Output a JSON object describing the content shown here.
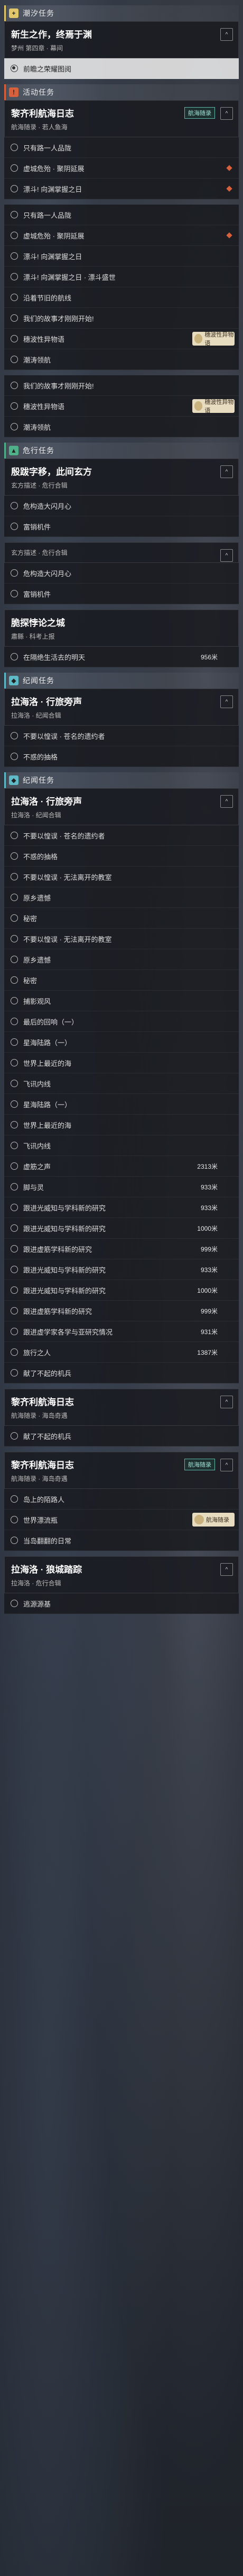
{
  "sections": [
    {
      "head": "潮汐任务",
      "color": "yellow",
      "icon": "+",
      "card": {
        "title": "新生之作，终焉于渊",
        "sub": "梦州 第四章 · 幕间",
        "tag": "",
        "fold": "^"
      },
      "rows": [
        {
          "label": "前瞻之荣耀图阅",
          "active": true
        }
      ]
    },
    {
      "head": "活动任务",
      "color": "red",
      "icon": "!",
      "card": {
        "title": "黎齐利航海日志",
        "sub": "航海随录 · 若人鱼海",
        "tag": "航海随录",
        "fold": "^"
      },
      "rows": [
        {
          "label": "只有路一人品陇"
        },
        {
          "label": "虚城危殆 · 聚阴延展",
          "dia": true
        },
        {
          "label": "漂斗! 向渊掌握之日",
          "dia": true
        }
      ]
    },
    {
      "head": "",
      "color": "yellow",
      "icon": "+",
      "card": null,
      "rows": [
        {
          "label": "只有路一人品陇"
        },
        {
          "label": "虚城危殆 · 聚阴延展",
          "dia": true
        },
        {
          "label": "漂斗! 向渊掌握之日"
        },
        {
          "label": "漂斗! 向渊掌握之日 · 漂斗盛世"
        },
        {
          "label": "沿着节旧的航线"
        },
        {
          "label": "我们的故事才刚刚开始!"
        },
        {
          "label": "穗波性异物语",
          "badge": "穗波性异物语"
        },
        {
          "label": "潮涛领航"
        }
      ]
    },
    {
      "head": "",
      "color": "yellow",
      "icon": "",
      "card": null,
      "rows": [
        {
          "label": "我们的故事才刚刚开始!"
        },
        {
          "label": "穗波性异物语",
          "badge": "穗波性异物语"
        },
        {
          "label": "潮涛领航"
        }
      ]
    },
    {
      "head": "危行任务",
      "color": "green",
      "icon": "▲",
      "card": {
        "title": "殷跋字移，此间玄方",
        "sub": "玄方描述 · 危行合辑",
        "tag": "",
        "fold": "^"
      },
      "rows": [
        {
          "label": "危构造大闪月心"
        },
        {
          "label": "富销机件"
        }
      ]
    },
    {
      "head": "",
      "color": "yellow",
      "icon": "",
      "card": {
        "title": "",
        "sub": "玄方描述 · 危行合辑",
        "tag": "",
        "fold": "^"
      },
      "rows": [
        {
          "label": "危构造大闪月心"
        },
        {
          "label": "富销机件"
        }
      ]
    },
    {
      "head": "",
      "color": "yellow",
      "icon": "",
      "card": {
        "title": "脆探悖论之城",
        "sub": "肅縣 · 科考上报",
        "tag": "",
        "fold": ""
      },
      "rows": [
        {
          "label": "在隔绝生活去的明天",
          "val": "956米"
        }
      ]
    },
    {
      "head": "纪闻任务",
      "color": "teal",
      "icon": "◆",
      "card": {
        "title": "拉海洛 · 行旅旁声",
        "sub": "拉海洛 · 纪闻合辑",
        "tag": "",
        "fold": "^"
      },
      "rows": [
        {
          "label": "不要以惶误 · 苍名的遗约者"
        },
        {
          "label": "不惑的抽格"
        }
      ]
    },
    {
      "head": "纪闻任务",
      "color": "teal",
      "icon": "◆",
      "card": {
        "title": "拉海洛 · 行旅旁声",
        "sub": "拉海洛 · 纪闻合辑",
        "tag": "",
        "fold": "^"
      },
      "rows": [
        {
          "label": "不要以惶误 · 苍名的遗约者"
        },
        {
          "label": "不惑的抽格"
        },
        {
          "label": "不要以惶误 · 无法离开的教室"
        },
        {
          "label": "原乡遗憾"
        },
        {
          "label": "秘密"
        },
        {
          "label": "不要以惶误 · 无法离开的教室"
        },
        {
          "label": "原乡遗憾"
        },
        {
          "label": "秘密"
        },
        {
          "label": "捕影观风"
        },
        {
          "label": "最后的回响（一）"
        },
        {
          "label": "星海陆路（一）"
        },
        {
          "label": "世界上最近的海"
        },
        {
          "label": "飞讯内线"
        },
        {
          "label": "星海陆路（一）"
        },
        {
          "label": "世界上最近的海"
        },
        {
          "label": "飞讯内线"
        },
        {
          "label": "虚筋之声",
          "val": "2313米"
        },
        {
          "label": "脚与灵",
          "val": "933米"
        },
        {
          "label": "跟进光威知与学科新的研究",
          "val": "933米"
        },
        {
          "label": "跟进光威知与学科新的研究",
          "val": "1000米"
        },
        {
          "label": "跟进虚筋学科新的研究",
          "val": "999米"
        },
        {
          "label": "跟进光威知与学科新的研究",
          "val": "933米"
        },
        {
          "label": "跟进光威知与学科新的研究",
          "val": "1000米"
        },
        {
          "label": "跟进虚筋学科新的研究",
          "val": "999米"
        },
        {
          "label": "跟进虚学家各学与亚研究情况",
          "val": "931米"
        },
        {
          "label": "旅行之人",
          "val": "1387米"
        },
        {
          "label": "献了不起的机兵"
        }
      ]
    },
    {
      "head": "",
      "color": "yellow",
      "icon": "",
      "card": {
        "title": "黎齐利航海日志",
        "sub": "航海随录 · 海岛奇遇",
        "tag": "",
        "fold": "^"
      },
      "rows": [
        {
          "label": "献了不起的机兵"
        }
      ]
    },
    {
      "head": "",
      "color": "yellow",
      "icon": "",
      "card": {
        "title": "黎齐利航海日志",
        "sub": "航海随录 · 海岛奇遇",
        "tag": "航海随录",
        "fold": "^"
      },
      "rows": [
        {
          "label": "岛上的陌路人"
        },
        {
          "label": "世界漂流瓶",
          "badge": "航海随录"
        },
        {
          "label": "当岛翻翻的日常"
        }
      ]
    },
    {
      "head": "",
      "color": "yellow",
      "icon": "",
      "card": {
        "title": "拉海洛 · 狼城踏踪",
        "sub": "拉海洛 · 危行合辑",
        "tag": "",
        "fold": "^"
      },
      "rows": [
        {
          "label": "逃源源基"
        }
      ]
    }
  ]
}
